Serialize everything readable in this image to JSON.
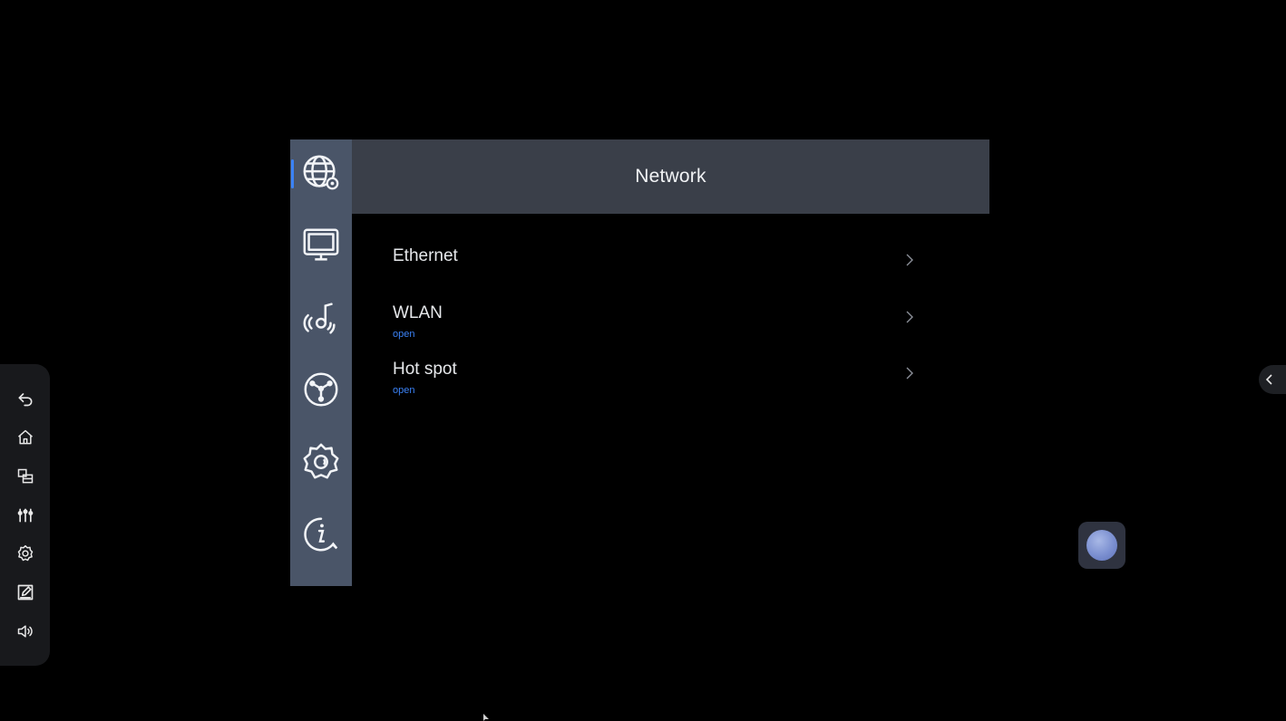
{
  "colors": {
    "background": "#000000",
    "rail": "#4a5568",
    "title_bar": "#3a3f49",
    "accent": "#3b82f6",
    "text": "#e6e8eb",
    "toolbar": "#18191c"
  },
  "left_toolbar": {
    "items": [
      {
        "icon": "back-icon"
      },
      {
        "icon": "home-icon"
      },
      {
        "icon": "multitask-icon"
      },
      {
        "icon": "equalizer-icon"
      },
      {
        "icon": "settings-icon"
      },
      {
        "icon": "annotate-icon"
      },
      {
        "icon": "volume-icon"
      }
    ]
  },
  "settings": {
    "title": "Network",
    "categories": [
      {
        "icon": "network-globe-icon",
        "active": true
      },
      {
        "icon": "display-monitor-icon",
        "active": false
      },
      {
        "icon": "wireless-projection-icon",
        "active": false
      },
      {
        "icon": "apps-cube-icon",
        "active": false
      },
      {
        "icon": "system-gear-icon",
        "active": false
      },
      {
        "icon": "about-info-icon",
        "active": false
      }
    ],
    "items": [
      {
        "label": "Ethernet",
        "status": ""
      },
      {
        "label": "WLAN",
        "status": "open"
      },
      {
        "label": "Hot spot",
        "status": "open"
      }
    ]
  },
  "edge_handle": {
    "icon": "chevron-left-icon"
  },
  "floating_ball": {
    "icon": "assistive-ball-icon"
  }
}
